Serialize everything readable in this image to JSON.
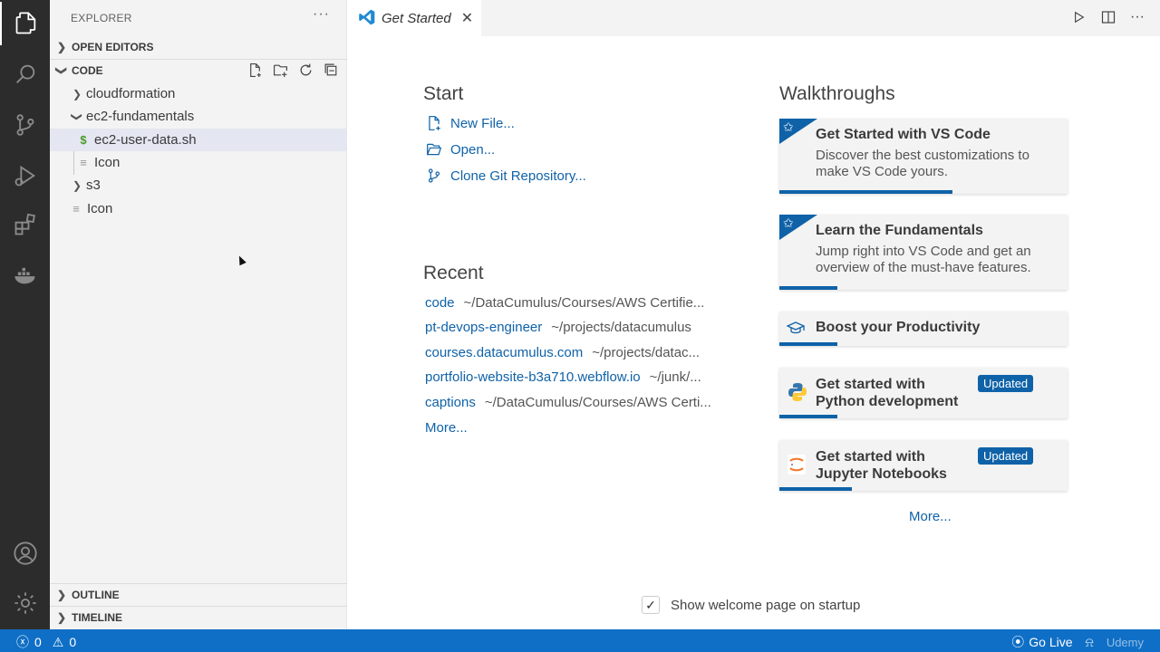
{
  "colors": {
    "accent": "#0f62a8",
    "activity_bar": "#2c2c2c",
    "sidebar": "#f3f3f3",
    "status_bar": "#0f6fc6"
  },
  "activity_bar": {
    "items": [
      "files-icon",
      "search-icon",
      "source-control-icon",
      "run-debug-icon",
      "extensions-icon",
      "docker-icon"
    ],
    "bottom": [
      "account-icon",
      "manage-gear-icon"
    ]
  },
  "sidebar": {
    "title": "EXPLORER",
    "more": "···",
    "open_editors": "OPEN EDITORS",
    "workspace": "CODE",
    "tree": [
      {
        "label": "cloudformation",
        "type": "folder",
        "expanded": false
      },
      {
        "label": "ec2-fundamentals",
        "type": "folder",
        "expanded": true
      },
      {
        "label": "ec2-user-data.sh",
        "type": "file",
        "icon": "$",
        "selected": true
      },
      {
        "label": "Icon",
        "type": "file"
      },
      {
        "label": "s3",
        "type": "folder",
        "expanded": false
      },
      {
        "label": "Icon",
        "type": "file"
      }
    ],
    "outline": "OUTLINE",
    "timeline": "TIMELINE"
  },
  "tab": {
    "title": "Get Started",
    "close": "✕"
  },
  "welcome": {
    "start": {
      "heading": "Start",
      "items": [
        "New File...",
        "Open...",
        "Clone Git Repository..."
      ]
    },
    "recent": {
      "heading": "Recent",
      "items": [
        {
          "name": "code",
          "path": "~/DataCumulus/Courses/AWS Certifie..."
        },
        {
          "name": "pt-devops-engineer",
          "path": "~/projects/datacumulus"
        },
        {
          "name": "courses.datacumulus.com",
          "path": "~/projects/datac..."
        },
        {
          "name": "portfolio-website-b3a710.webflow.io",
          "path": "~/junk/..."
        },
        {
          "name": "captions",
          "path": "~/DataCumulus/Courses/AWS Certi..."
        }
      ],
      "more": "More..."
    },
    "walkthroughs": {
      "heading": "Walkthroughs",
      "cards": [
        {
          "title": "Get Started with VS Code",
          "desc": "Discover the best customizations to make VS Code yours.",
          "progress": 0.6
        },
        {
          "title": "Learn the Fundamentals",
          "desc": "Jump right into VS Code and get an overview of the must-have features.",
          "progress": 0.2
        },
        {
          "title": "Boost your Productivity",
          "desc": "",
          "progress": 0.2
        },
        {
          "title": "Get started with Python development",
          "badge": "Updated",
          "progress": 0.2
        },
        {
          "title": "Get started with Jupyter Notebooks",
          "badge": "Updated",
          "progress": 0.25
        }
      ],
      "more": "More..."
    },
    "show_on_startup": "Show welcome page on startup",
    "show_on_startup_checked": true
  },
  "statusbar": {
    "errors": "0",
    "warnings": "0",
    "go_live": "Go Live",
    "watermark": "Udemy"
  }
}
